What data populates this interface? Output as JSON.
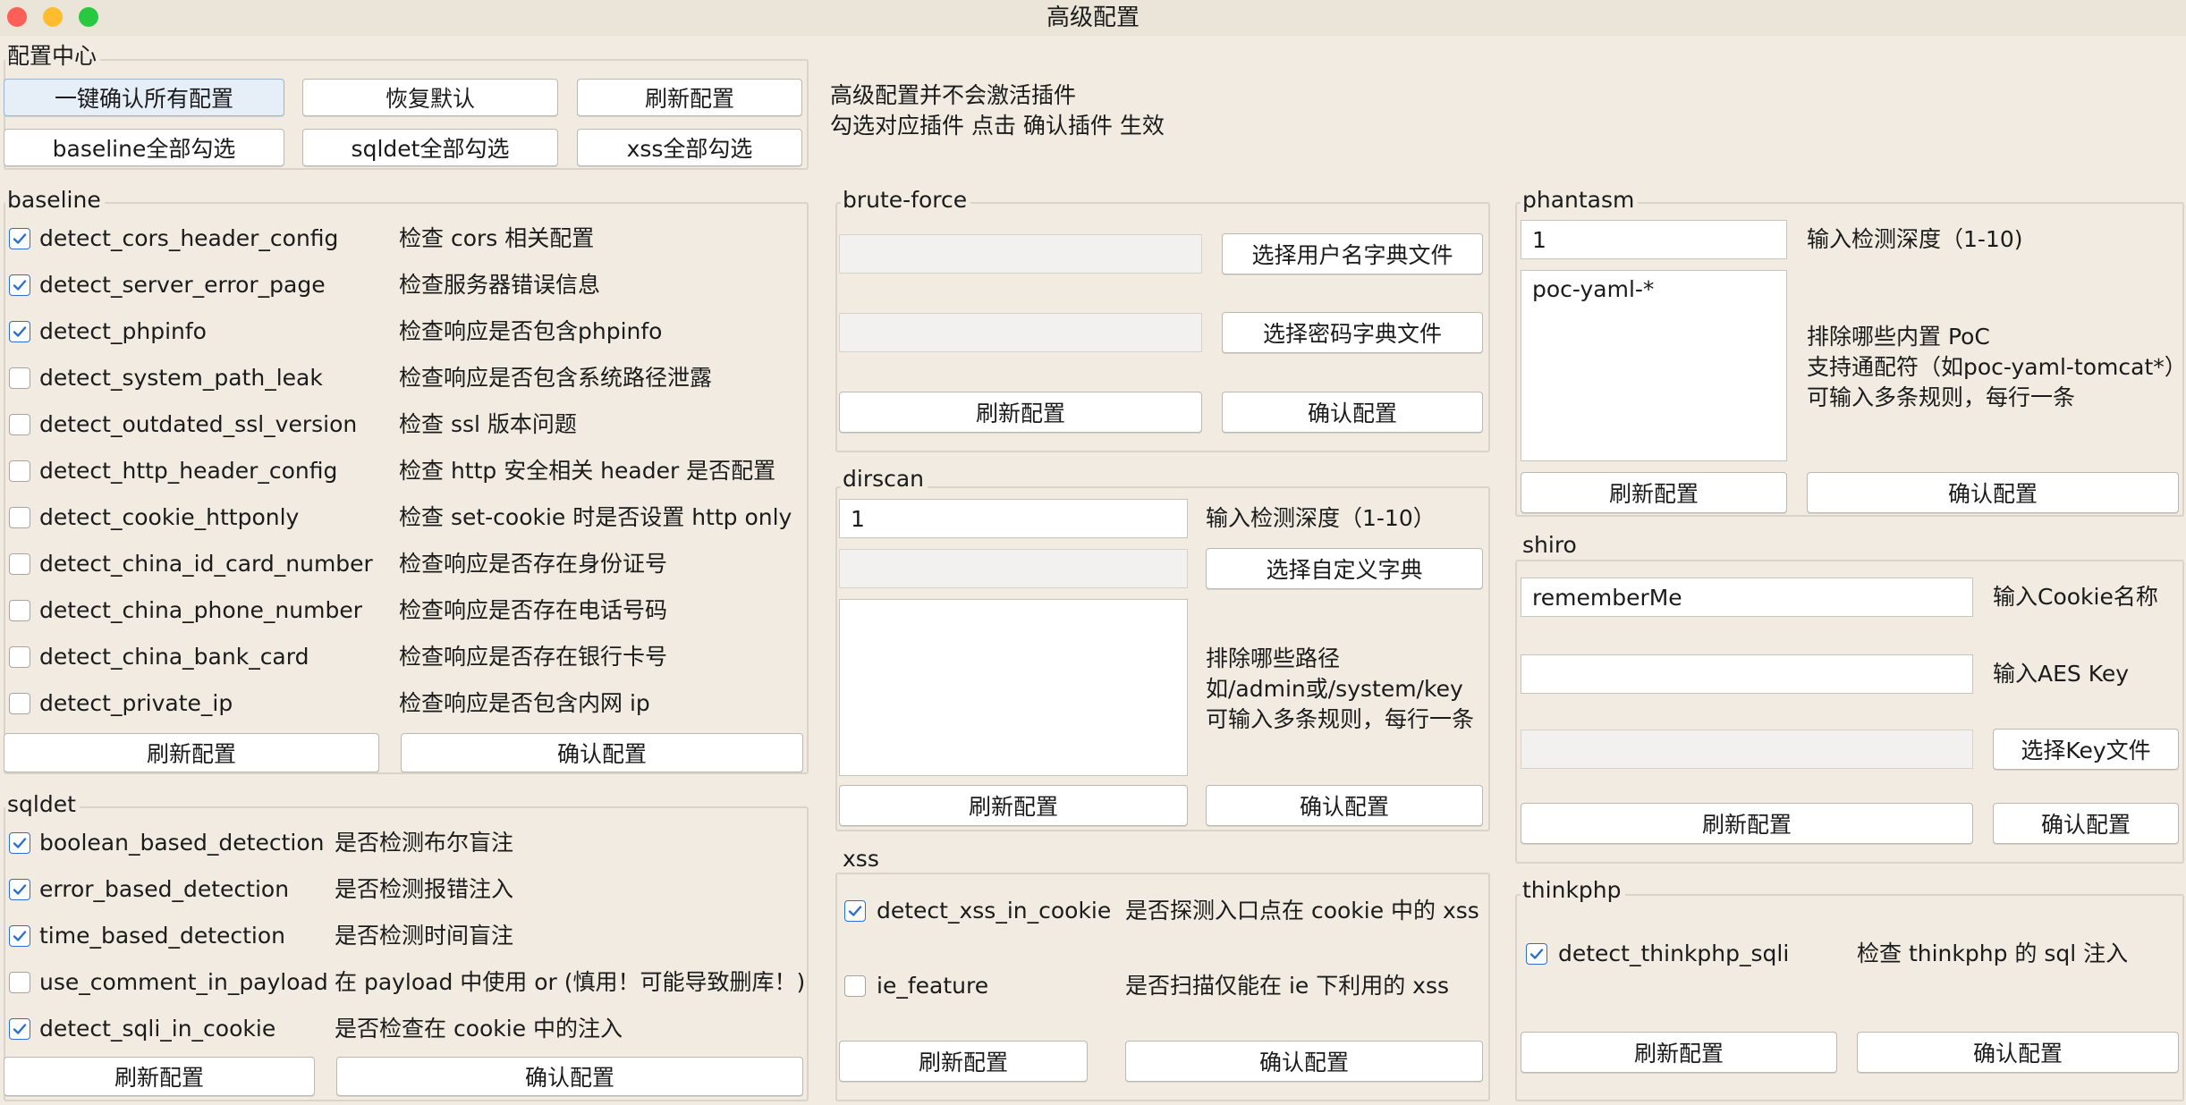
{
  "window": {
    "title": "高级配置"
  },
  "config_center": {
    "label": "配置中心",
    "confirm_all": "一键确认所有配置",
    "restore_default": "恢复默认",
    "refresh": "刷新配置",
    "baseline_all": "baseline全部勾选",
    "sqldet_all": "sqldet全部勾选",
    "xss_all": "xss全部勾选",
    "note1": "高级配置并不会激活插件",
    "note2": "勾选对应插件 点击 确认插件 生效"
  },
  "baseline": {
    "label": "baseline",
    "items": [
      {
        "name": "detect_cors_header_config",
        "desc": "检查 cors 相关配置",
        "checked": true
      },
      {
        "name": "detect_server_error_page",
        "desc": "检查服务器错误信息",
        "checked": true
      },
      {
        "name": "detect_phpinfo",
        "desc": "检查响应是否包含phpinfo",
        "checked": true
      },
      {
        "name": "detect_system_path_leak",
        "desc": "检查响应是否包含系统路径泄露",
        "checked": false
      },
      {
        "name": "detect_outdated_ssl_version",
        "desc": "检查 ssl 版本问题",
        "checked": false
      },
      {
        "name": "detect_http_header_config",
        "desc": "检查 http 安全相关 header 是否配置",
        "checked": false
      },
      {
        "name": "detect_cookie_httponly",
        "desc": "检查 set-cookie 时是否设置 http only",
        "checked": false
      },
      {
        "name": "detect_china_id_card_number",
        "desc": "检查响应是否存在身份证号",
        "checked": false
      },
      {
        "name": "detect_china_phone_number",
        "desc": "检查响应是否存在电话号码",
        "checked": false
      },
      {
        "name": "detect_china_bank_card",
        "desc": "检查响应是否存在银行卡号",
        "checked": false
      },
      {
        "name": "detect_private_ip",
        "desc": "检查响应是否包含内网 ip",
        "checked": false
      }
    ],
    "refresh": "刷新配置",
    "confirm": "确认配置"
  },
  "sqldet": {
    "label": "sqldet",
    "items": [
      {
        "name": "boolean_based_detection",
        "desc": "是否检测布尔盲注",
        "checked": true
      },
      {
        "name": "error_based_detection",
        "desc": "是否检测报错注入",
        "checked": true
      },
      {
        "name": "time_based_detection",
        "desc": "是否检测时间盲注",
        "checked": true
      },
      {
        "name": "use_comment_in_payload",
        "desc": "在 payload 中使用 or (慎用！可能导致删库！)",
        "checked": false
      },
      {
        "name": "detect_sqli_in_cookie",
        "desc": "是否检查在 cookie 中的注入",
        "checked": true
      }
    ],
    "refresh": "刷新配置",
    "confirm": "确认配置"
  },
  "brute_force": {
    "label": "brute-force",
    "user_dict_value": "",
    "pass_dict_value": "",
    "choose_user_dict": "选择用户名字典文件",
    "choose_pass_dict": "选择密码字典文件",
    "refresh": "刷新配置",
    "confirm": "确认配置"
  },
  "dirscan": {
    "label": "dirscan",
    "depth_value": "1",
    "depth_label": "输入检测深度（1-10）",
    "dict_value": "",
    "choose_dict": "选择自定义字典",
    "exclude_value": "",
    "exclude_line1": "排除哪些路径",
    "exclude_line2": "如/admin或/system/key",
    "exclude_line3": "可输入多条规则，每行一条",
    "refresh": "刷新配置",
    "confirm": "确认配置"
  },
  "xss": {
    "label": "xss",
    "items": [
      {
        "name": "detect_xss_in_cookie",
        "desc": "是否探测入口点在 cookie 中的 xss",
        "checked": true
      },
      {
        "name": "ie_feature",
        "desc": "是否扫描仅能在 ie 下利用的 xss",
        "checked": false
      }
    ],
    "refresh": "刷新配置",
    "confirm": "确认配置"
  },
  "phantasm": {
    "label": "phantasm",
    "depth_value": "1",
    "depth_label": "输入检测深度（1-10)",
    "exclude_value": "poc-yaml-*",
    "exclude_line1": "排除哪些内置 PoC",
    "exclude_line2": "支持通配符（如poc-yaml-tomcat*）",
    "exclude_line3": "可输入多条规则，每行一条",
    "refresh": "刷新配置",
    "confirm": "确认配置"
  },
  "shiro": {
    "label": "shiro",
    "cookie_value": "rememberMe",
    "cookie_label": "输入Cookie名称",
    "aes_value": "",
    "aes_label": "输入AES Key",
    "keyfile_value": "",
    "choose_key": "选择Key文件",
    "refresh": "刷新配置",
    "confirm": "确认配置"
  },
  "thinkphp": {
    "label": "thinkphp",
    "items": [
      {
        "name": "detect_thinkphp_sqli",
        "desc": "检查 thinkphp 的 sql 注入",
        "checked": true
      }
    ],
    "refresh": "刷新配置",
    "confirm": "确认配置"
  },
  "colors": {
    "accent": "#2b6fd0",
    "background": "#f1ebe1"
  }
}
